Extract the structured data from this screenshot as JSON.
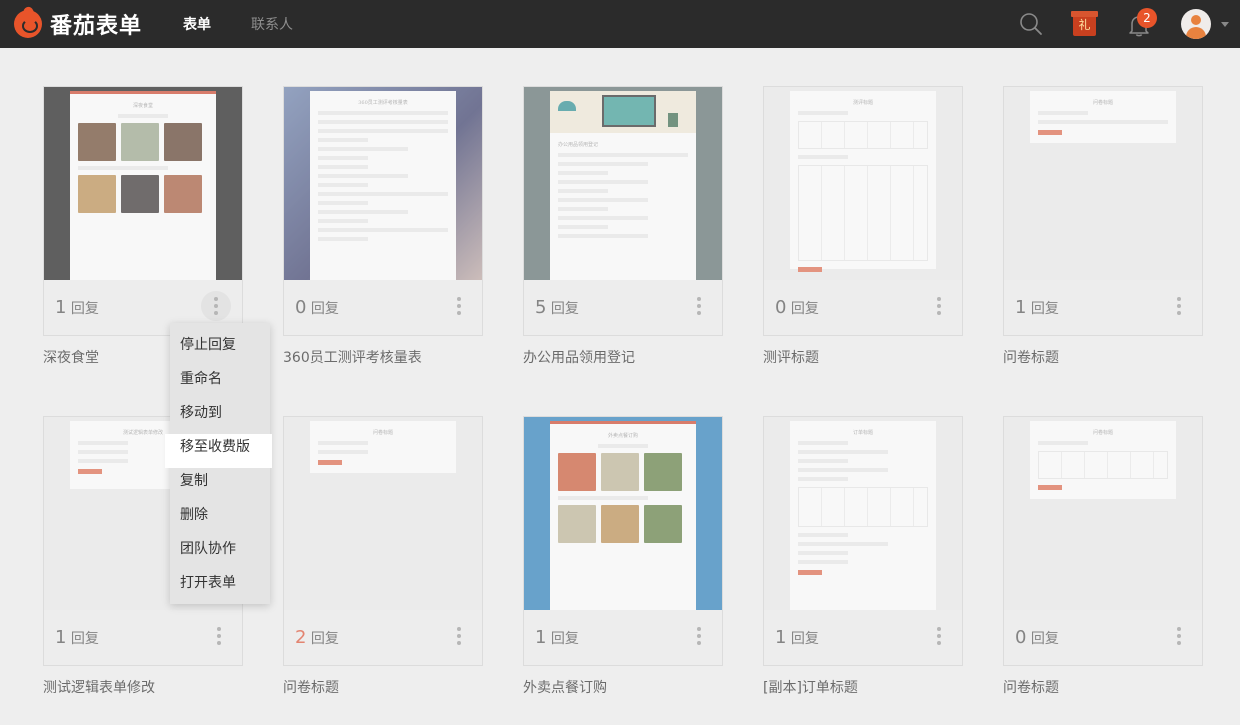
{
  "app": {
    "logo_text": "番茄表单",
    "brand_color": "#e8542a"
  },
  "nav": {
    "tabs": [
      {
        "label": "表单",
        "active": true
      },
      {
        "label": "联系人",
        "active": false
      }
    ]
  },
  "toolbar": {
    "gift_label": "礼",
    "notification_count": "2",
    "icons": [
      "search-icon",
      "gift-icon",
      "bell-icon",
      "avatar",
      "chevron-down-icon"
    ]
  },
  "reply_suffix": "回复",
  "forms": [
    {
      "title": "深夜食堂",
      "replies": "1",
      "thumb_title": "深夜食堂"
    },
    {
      "title": "360员工测评考核量表",
      "replies": "0",
      "thumb_title": "360员工测评考核量表"
    },
    {
      "title": "办公用品领用登记",
      "replies": "5",
      "thumb_title": "办公用品领用登记"
    },
    {
      "title": "测评标题",
      "replies": "0",
      "thumb_title": "测评标题"
    },
    {
      "title": "问卷标题",
      "replies": "1",
      "thumb_title": "问卷标题"
    },
    {
      "title": "测试逻辑表单修改",
      "replies": "1",
      "thumb_title": "测试逻辑表单修改"
    },
    {
      "title": "问卷标题",
      "replies": "2",
      "thumb_title": "问卷标题"
    },
    {
      "title": "外卖点餐订购",
      "replies": "1",
      "thumb_title": "外卖点餐订购"
    },
    {
      "title": "[副本]订单标题",
      "replies": "1",
      "thumb_title": "订单标题"
    },
    {
      "title": "问卷标题",
      "replies": "0",
      "thumb_title": "问卷标题"
    }
  ],
  "context_menu": {
    "items": [
      "停止回复",
      "重命名",
      "移动到",
      "移至收费版",
      "复制",
      "删除",
      "团队协作",
      "打开表单"
    ],
    "highlighted": "移至收费版"
  }
}
